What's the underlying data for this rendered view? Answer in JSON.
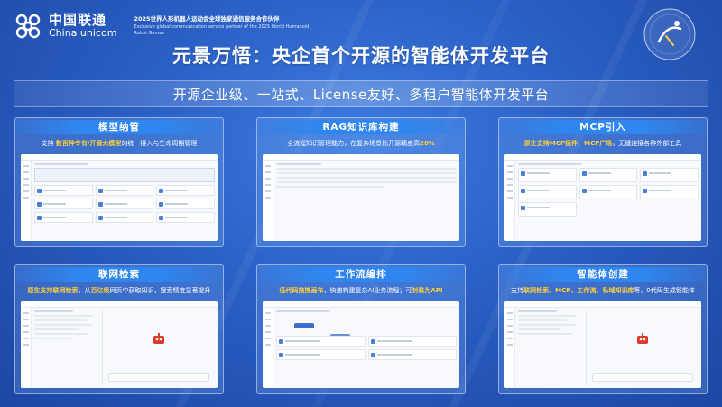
{
  "header": {
    "logo_cn": "中国联通",
    "logo_en": "China unicom",
    "event_line1": "2025世界人形机器人运动会全球独家通信服务合作伙伴",
    "event_line2": "Exclusive global communication service partner of the 2025 World Humanoid Robot Games",
    "badge_text": "世界人形机器人运动会"
  },
  "title": "元景万悟：央企首个开源的智能体开发平台",
  "subtitle": "开源企业级、一站式、License友好、多租户智能体开发平台",
  "colors": {
    "highlight": "#ffcf3a",
    "card_header": "#2f86ee",
    "background": "#2a5fc4"
  },
  "cards": [
    {
      "title": "模型纳管",
      "desc_parts": [
        {
          "text": "支持 ",
          "hl": false
        },
        {
          "text": "数百种专有/开源大模型",
          "hl": true
        },
        {
          "text": "的统一接入与生命周期管理",
          "hl": false
        }
      ]
    },
    {
      "title": "RAG知识库构建",
      "desc_parts": [
        {
          "text": "全流程知识管理能力，在复杂场景比开源精度高",
          "hl": false
        },
        {
          "text": "20%",
          "hl": true
        }
      ]
    },
    {
      "title": "MCP引入",
      "desc_parts": [
        {
          "text": "原生支持MCP插件、MCP广场",
          "hl": true
        },
        {
          "text": "，无缝连接各种外部工具",
          "hl": false
        }
      ]
    },
    {
      "title": "联网检索",
      "desc_parts": [
        {
          "text": "原生支持联网检索",
          "hl": true
        },
        {
          "text": "，从",
          "hl": false
        },
        {
          "text": "百亿级",
          "hl": true
        },
        {
          "text": "网页中获取知识，搜索精度显著提升",
          "hl": false
        }
      ]
    },
    {
      "title": "工作流编排",
      "desc_parts": [
        {
          "text": "低代码拖拽画布",
          "hl": true
        },
        {
          "text": "，快速构建复杂AI业务流程；可",
          "hl": false
        },
        {
          "text": "封装为API",
          "hl": true
        }
      ]
    },
    {
      "title": "智能体创建",
      "desc_parts": [
        {
          "text": "支持",
          "hl": false
        },
        {
          "text": "联网检索、MCP、工作流、私域知识库",
          "hl": true
        },
        {
          "text": "等，0代码生成智能体",
          "hl": false
        }
      ]
    }
  ]
}
